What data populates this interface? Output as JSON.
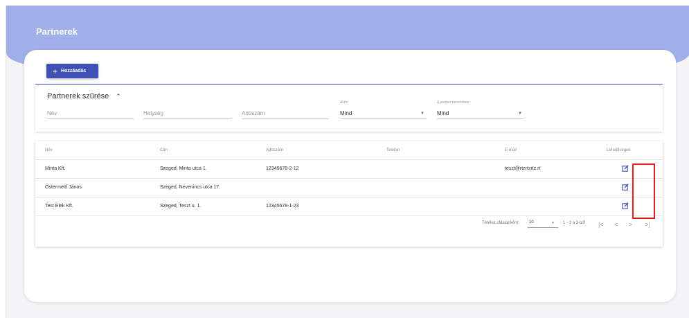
{
  "header": {
    "title": "Partnerek"
  },
  "toolbar": {
    "add_label": "Hozzáadás",
    "add_icon": "plus-icon"
  },
  "filter": {
    "title": "Partnerek szűrése",
    "toggle_icon": "chevron-up-icon",
    "name_placeholder": "Név",
    "city_placeholder": "Helység",
    "tax_placeholder": "Adószám",
    "active_label": "Aktív",
    "active_value": "Mind",
    "category_label": "A partner besorolása",
    "category_value": "Mind"
  },
  "table": {
    "columns": [
      "Név",
      "Cím",
      "Adószám",
      "Telefon",
      "E-mail",
      "Lehetőségek"
    ],
    "rows": [
      {
        "name": "Minta Kft.",
        "address": "Szeged, Minta utca 1.",
        "tax": "12345678-2-12",
        "phone": "",
        "email": "teszt@rtzrtzrtz.rt"
      },
      {
        "name": "Őstermelő János",
        "address": "Szeged, Nevenincs utca 17.",
        "tax": "",
        "phone": "",
        "email": ""
      },
      {
        "name": "Test Elek Kft.",
        "address": "Szeged, Teszt u. 1.",
        "tax": "12345678-1-23",
        "phone": "",
        "email": ""
      }
    ],
    "edit_icon": "edit-icon"
  },
  "paginator": {
    "per_page_label": "Tételek oldalanként:",
    "per_page_value": "10",
    "range": "1 - 3 a 3-ból",
    "first_glyph": "|<",
    "prev_glyph": "<",
    "next_glyph": ">",
    "last_glyph": ">|"
  },
  "colors": {
    "header": "#9fb0e8",
    "accent": "#3f51b5",
    "highlight": "#e02020"
  }
}
